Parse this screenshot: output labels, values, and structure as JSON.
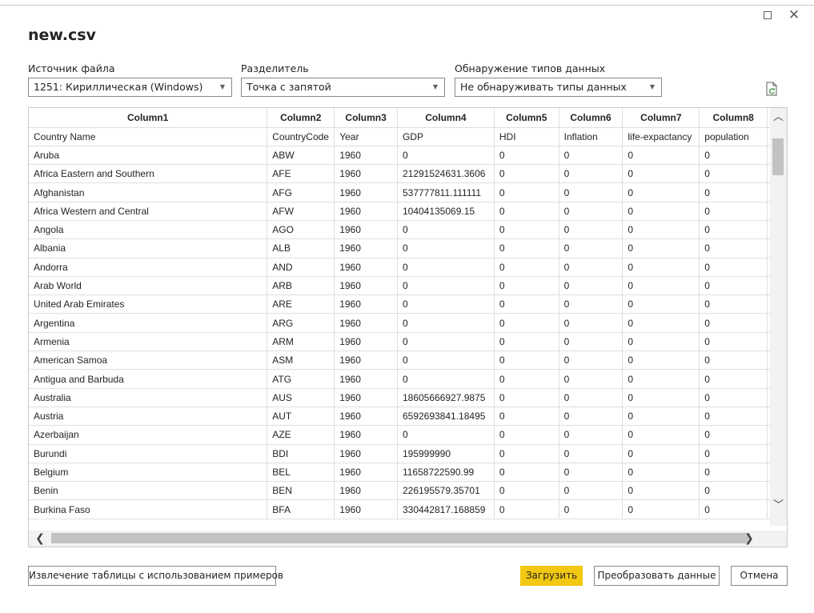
{
  "dialog": {
    "title": "new.csv",
    "maximize_glyph": "",
    "close_glyph": "✕"
  },
  "options": {
    "file_origin_label": "Источник файла",
    "file_origin_value": "1251: Кириллическая (Windows)",
    "delimiter_label": "Разделитель",
    "delimiter_value": "Точка с запятой",
    "type_detection_label": "Обнаружение типов данных",
    "type_detection_value": "Не обнаруживать типы данных"
  },
  "table": {
    "columns": [
      "Column1",
      "Column2",
      "Column3",
      "Column4",
      "Column5",
      "Column6",
      "Column7",
      "Column8"
    ],
    "rows": [
      [
        "Country Name",
        "CountryCode",
        "Year",
        "GDP",
        "HDI",
        "Inflation",
        "life-expactancy",
        "population"
      ],
      [
        "Aruba",
        "ABW",
        "1960",
        "0",
        "0",
        "0",
        "0",
        "0"
      ],
      [
        "Africa Eastern and Southern",
        "AFE",
        "1960",
        "21291524631.3606",
        "0",
        "0",
        "0",
        "0"
      ],
      [
        "Afghanistan",
        "AFG",
        "1960",
        "537777811.111111",
        "0",
        "0",
        "0",
        "0"
      ],
      [
        "Africa Western and Central",
        "AFW",
        "1960",
        "10404135069.15",
        "0",
        "0",
        "0",
        "0"
      ],
      [
        "Angola",
        "AGO",
        "1960",
        "0",
        "0",
        "0",
        "0",
        "0"
      ],
      [
        "Albania",
        "ALB",
        "1960",
        "0",
        "0",
        "0",
        "0",
        "0"
      ],
      [
        "Andorra",
        "AND",
        "1960",
        "0",
        "0",
        "0",
        "0",
        "0"
      ],
      [
        "Arab World",
        "ARB",
        "1960",
        "0",
        "0",
        "0",
        "0",
        "0"
      ],
      [
        "United Arab Emirates",
        "ARE",
        "1960",
        "0",
        "0",
        "0",
        "0",
        "0"
      ],
      [
        "Argentina",
        "ARG",
        "1960",
        "0",
        "0",
        "0",
        "0",
        "0"
      ],
      [
        "Armenia",
        "ARM",
        "1960",
        "0",
        "0",
        "0",
        "0",
        "0"
      ],
      [
        "American Samoa",
        "ASM",
        "1960",
        "0",
        "0",
        "0",
        "0",
        "0"
      ],
      [
        "Antigua and Barbuda",
        "ATG",
        "1960",
        "0",
        "0",
        "0",
        "0",
        "0"
      ],
      [
        "Australia",
        "AUS",
        "1960",
        "18605666927.9875",
        "0",
        "0",
        "0",
        "0"
      ],
      [
        "Austria",
        "AUT",
        "1960",
        "6592693841.18495",
        "0",
        "0",
        "0",
        "0"
      ],
      [
        "Azerbaijan",
        "AZE",
        "1960",
        "0",
        "0",
        "0",
        "0",
        "0"
      ],
      [
        "Burundi",
        "BDI",
        "1960",
        "195999990",
        "0",
        "0",
        "0",
        "0"
      ],
      [
        "Belgium",
        "BEL",
        "1960",
        "11658722590.99",
        "0",
        "0",
        "0",
        "0"
      ],
      [
        "Benin",
        "BEN",
        "1960",
        "226195579.35701",
        "0",
        "0",
        "0",
        "0"
      ],
      [
        "Burkina Faso",
        "BFA",
        "1960",
        "330442817.168859",
        "0",
        "0",
        "0",
        "0"
      ]
    ]
  },
  "buttons": {
    "extract_label": "Извлечение таблицы с использованием примеров",
    "load_label": "Загрузить",
    "transform_label": "Преобразовать данные",
    "cancel_label": "Отмена"
  },
  "icons": {
    "refresh": "refresh-file-icon",
    "scroll_up": "chevron-up-icon",
    "scroll_down": "chevron-down-icon",
    "scroll_left": "chevron-left-icon",
    "scroll_right": "chevron-right-icon"
  },
  "colors": {
    "primary_button": "#f2c811",
    "border": "#8a8886",
    "grid": "#e1dfdd"
  }
}
